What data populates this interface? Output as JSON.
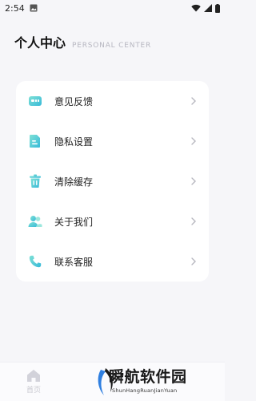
{
  "status_bar": {
    "time": "2:54"
  },
  "header": {
    "title": "个人中心",
    "subtitle": "PERSONAL CENTER"
  },
  "menu": {
    "items": [
      {
        "label": "意见反馈",
        "icon": "feedback-icon"
      },
      {
        "label": "隐私设置",
        "icon": "privacy-icon"
      },
      {
        "label": "清除缓存",
        "icon": "trash-icon"
      },
      {
        "label": "关于我们",
        "icon": "users-icon"
      },
      {
        "label": "联系客服",
        "icon": "phone-icon"
      }
    ]
  },
  "tabbar": {
    "home_label": "首页"
  },
  "watermark": {
    "text": "瞬航软件园",
    "sub": "ShunHangRuanJianYuan"
  },
  "colors": {
    "accent": "#3fc7c9",
    "background": "#f6f6f9"
  }
}
